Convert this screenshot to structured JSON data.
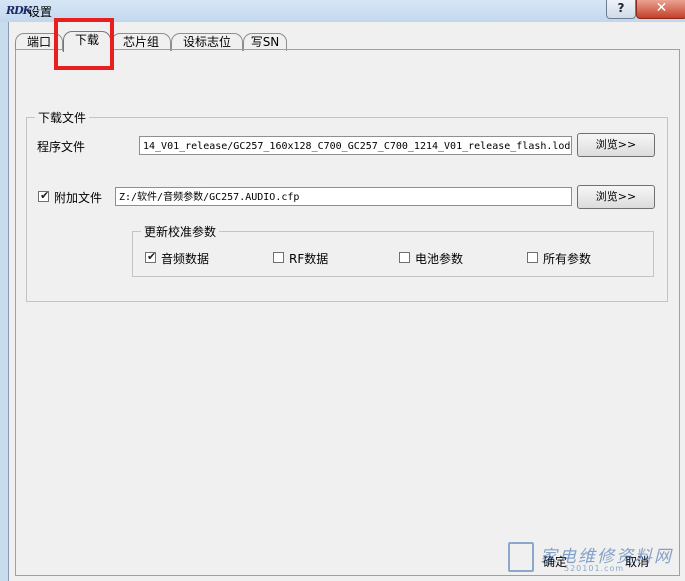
{
  "window": {
    "title": "设置",
    "help_label": "?",
    "close_label": "✕"
  },
  "tabs": [
    {
      "label": "端口"
    },
    {
      "label": "下载"
    },
    {
      "label": "芯片组"
    },
    {
      "label": "设标志位"
    },
    {
      "label": "写SN"
    }
  ],
  "active_tab": "下载",
  "download_group": {
    "title": "下载文件",
    "program_file_label": "程序文件",
    "program_file_value": "14_V01_release/GC257_160x128_C700_GC257_C700_1214_V01_release_flash.lod",
    "browse_label": "浏览>>",
    "attach_file_label": "附加文件",
    "attach_checked": true,
    "attach_file_value": "Z:/软件/音频参数/GC257.AUDIO.cfp",
    "browse2_label": "浏览>>"
  },
  "calib_group": {
    "title": "更新校准参数",
    "options": [
      {
        "label": "音频数据",
        "checked": true
      },
      {
        "label": "RF数据",
        "checked": false
      },
      {
        "label": "电池参数",
        "checked": false
      },
      {
        "label": "所有参数",
        "checked": false
      }
    ]
  },
  "footer": {
    "ok_label": "确定",
    "cancel_label": "取消"
  },
  "watermark": {
    "text": "家电维修资料网",
    "sub": "520101.com"
  },
  "colors": {
    "highlight": "#e81f1f",
    "title_bar": "#c9dbee",
    "close_button": "#c4402a"
  }
}
